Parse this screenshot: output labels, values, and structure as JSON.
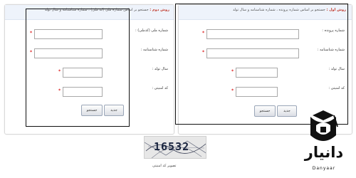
{
  "right_form": {
    "title_prefix": "روش اول :",
    "title_rest": "جستجو بر اساس شماره پرونده ، شماره شناسنامه و سال تولد",
    "fields": [
      {
        "label": "شماره پرونده :",
        "value": ""
      },
      {
        "label": "شماره شناسنامه :",
        "value": ""
      },
      {
        "label": "سال تولد :",
        "value": ""
      },
      {
        "label": "کد امنیتی :",
        "value": ""
      }
    ],
    "required_mark": "*",
    "search_button": "جستجو",
    "new_button": "جدید"
  },
  "left_form": {
    "title_prefix": "روش دوم :",
    "title_rest": "جستجو بر اساس شماره ملی (کد ملی) ، شماره شناسنامه و سال تولد",
    "fields": [
      {
        "label": "شماره ملی (کدملی) :",
        "value": ""
      },
      {
        "label": "شماره شناسنامه :",
        "value": ""
      },
      {
        "label": "سال تولد :",
        "value": ""
      },
      {
        "label": "کد امنیتی :",
        "value": ""
      }
    ],
    "required_mark": "*",
    "search_button": "جستجو",
    "new_button": "جدید"
  },
  "captcha": {
    "code": "16532",
    "caption": "تصویر کد امنیتی"
  },
  "brand": {
    "name": "دانیار",
    "latin": "Danyaar",
    "icon": "graduation-cap-logo"
  },
  "colors": {
    "header_bg": "#eef3fb",
    "required": "#dd2222",
    "title_accent": "#c0392b",
    "highlight_border": "#111111"
  }
}
